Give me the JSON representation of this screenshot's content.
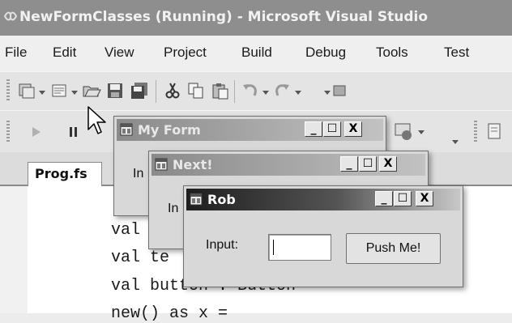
{
  "window": {
    "title": "NewFormClasses (Running) - Microsoft Visual Studio",
    "menu": [
      "File",
      "Edit",
      "View",
      "Project",
      "Build",
      "Debug",
      "Tools",
      "Test"
    ]
  },
  "editor": {
    "active_tab": "Prog.fs",
    "code_lines": [
      "val",
      "val te",
      "val button : Button",
      "new() as x ="
    ]
  },
  "forms": {
    "my_form": {
      "title": "My Form",
      "label_fragment": "In"
    },
    "next": {
      "title": "Next!",
      "label_fragment": "In"
    },
    "rob": {
      "title": "Rob",
      "input_label": "Input:",
      "input_value": "",
      "button_label": "Push Me!"
    },
    "caption_buttons": {
      "minimize": "_",
      "maximize": "☐",
      "close": "X"
    }
  }
}
